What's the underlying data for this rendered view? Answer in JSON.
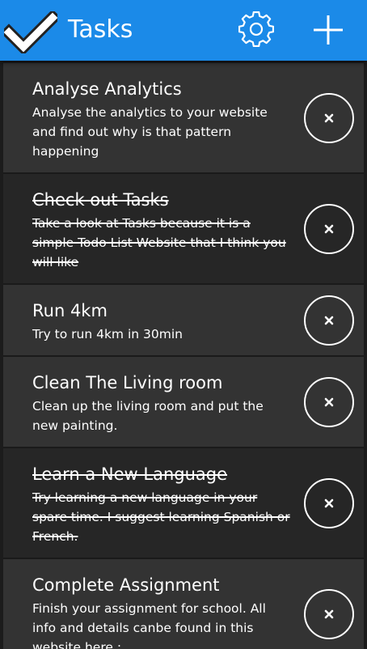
{
  "header": {
    "title": "Tasks",
    "logo_icon": "checkmark-icon",
    "settings_icon": "gear-icon",
    "add_icon": "plus-icon",
    "background": "#1b8ae8"
  },
  "tasks": [
    {
      "title": "Analyse Analytics",
      "description": "Analyse the analytics to your website and find out why is that pattern happening",
      "completed": false,
      "delete_icon": "close-icon"
    },
    {
      "title": "Check out Tasks",
      "description": "Take a look at Tasks because it is a simple Todo List Website that I think you will like",
      "completed": true,
      "delete_icon": "close-icon"
    },
    {
      "title": "Run 4km",
      "description": "Try to run 4km in 30min",
      "completed": false,
      "delete_icon": "close-icon"
    },
    {
      "title": "Clean The Living room",
      "description": "Clean up the living room and put the new painting.",
      "completed": false,
      "delete_icon": "close-icon"
    },
    {
      "title": "Learn a New Language",
      "description": "Try learning a new language in your spare time. I suggest learning Spanish or French.",
      "completed": true,
      "delete_icon": "close-icon"
    },
    {
      "title": "Complete Assignment",
      "description": "Finish your assignment for school. All info and details canbe found in this website here :",
      "completed": false,
      "delete_icon": "close-icon"
    }
  ]
}
